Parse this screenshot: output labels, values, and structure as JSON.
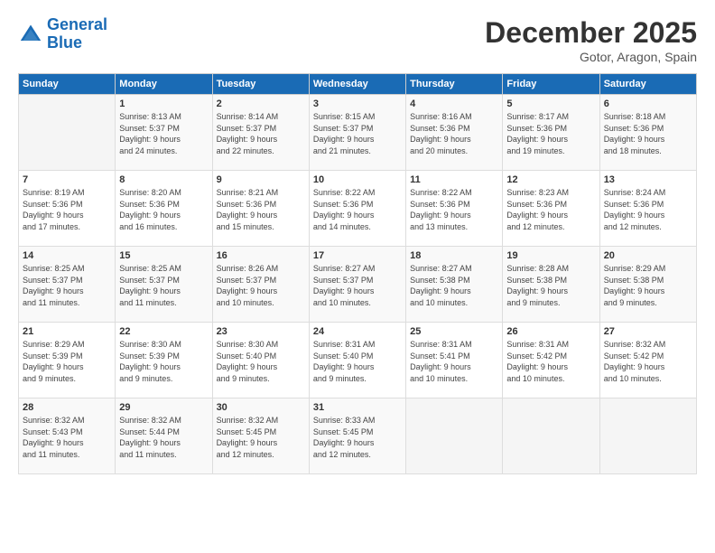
{
  "header": {
    "logo_line1": "General",
    "logo_line2": "Blue",
    "month": "December 2025",
    "location": "Gotor, Aragon, Spain"
  },
  "weekdays": [
    "Sunday",
    "Monday",
    "Tuesday",
    "Wednesday",
    "Thursday",
    "Friday",
    "Saturday"
  ],
  "weeks": [
    [
      {
        "day": "",
        "info": ""
      },
      {
        "day": "1",
        "info": "Sunrise: 8:13 AM\nSunset: 5:37 PM\nDaylight: 9 hours\nand 24 minutes."
      },
      {
        "day": "2",
        "info": "Sunrise: 8:14 AM\nSunset: 5:37 PM\nDaylight: 9 hours\nand 22 minutes."
      },
      {
        "day": "3",
        "info": "Sunrise: 8:15 AM\nSunset: 5:37 PM\nDaylight: 9 hours\nand 21 minutes."
      },
      {
        "day": "4",
        "info": "Sunrise: 8:16 AM\nSunset: 5:36 PM\nDaylight: 9 hours\nand 20 minutes."
      },
      {
        "day": "5",
        "info": "Sunrise: 8:17 AM\nSunset: 5:36 PM\nDaylight: 9 hours\nand 19 minutes."
      },
      {
        "day": "6",
        "info": "Sunrise: 8:18 AM\nSunset: 5:36 PM\nDaylight: 9 hours\nand 18 minutes."
      }
    ],
    [
      {
        "day": "7",
        "info": "Sunrise: 8:19 AM\nSunset: 5:36 PM\nDaylight: 9 hours\nand 17 minutes."
      },
      {
        "day": "8",
        "info": "Sunrise: 8:20 AM\nSunset: 5:36 PM\nDaylight: 9 hours\nand 16 minutes."
      },
      {
        "day": "9",
        "info": "Sunrise: 8:21 AM\nSunset: 5:36 PM\nDaylight: 9 hours\nand 15 minutes."
      },
      {
        "day": "10",
        "info": "Sunrise: 8:22 AM\nSunset: 5:36 PM\nDaylight: 9 hours\nand 14 minutes."
      },
      {
        "day": "11",
        "info": "Sunrise: 8:22 AM\nSunset: 5:36 PM\nDaylight: 9 hours\nand 13 minutes."
      },
      {
        "day": "12",
        "info": "Sunrise: 8:23 AM\nSunset: 5:36 PM\nDaylight: 9 hours\nand 12 minutes."
      },
      {
        "day": "13",
        "info": "Sunrise: 8:24 AM\nSunset: 5:36 PM\nDaylight: 9 hours\nand 12 minutes."
      }
    ],
    [
      {
        "day": "14",
        "info": "Sunrise: 8:25 AM\nSunset: 5:37 PM\nDaylight: 9 hours\nand 11 minutes."
      },
      {
        "day": "15",
        "info": "Sunrise: 8:25 AM\nSunset: 5:37 PM\nDaylight: 9 hours\nand 11 minutes."
      },
      {
        "day": "16",
        "info": "Sunrise: 8:26 AM\nSunset: 5:37 PM\nDaylight: 9 hours\nand 10 minutes."
      },
      {
        "day": "17",
        "info": "Sunrise: 8:27 AM\nSunset: 5:37 PM\nDaylight: 9 hours\nand 10 minutes."
      },
      {
        "day": "18",
        "info": "Sunrise: 8:27 AM\nSunset: 5:38 PM\nDaylight: 9 hours\nand 10 minutes."
      },
      {
        "day": "19",
        "info": "Sunrise: 8:28 AM\nSunset: 5:38 PM\nDaylight: 9 hours\nand 9 minutes."
      },
      {
        "day": "20",
        "info": "Sunrise: 8:29 AM\nSunset: 5:38 PM\nDaylight: 9 hours\nand 9 minutes."
      }
    ],
    [
      {
        "day": "21",
        "info": "Sunrise: 8:29 AM\nSunset: 5:39 PM\nDaylight: 9 hours\nand 9 minutes."
      },
      {
        "day": "22",
        "info": "Sunrise: 8:30 AM\nSunset: 5:39 PM\nDaylight: 9 hours\nand 9 minutes."
      },
      {
        "day": "23",
        "info": "Sunrise: 8:30 AM\nSunset: 5:40 PM\nDaylight: 9 hours\nand 9 minutes."
      },
      {
        "day": "24",
        "info": "Sunrise: 8:31 AM\nSunset: 5:40 PM\nDaylight: 9 hours\nand 9 minutes."
      },
      {
        "day": "25",
        "info": "Sunrise: 8:31 AM\nSunset: 5:41 PM\nDaylight: 9 hours\nand 10 minutes."
      },
      {
        "day": "26",
        "info": "Sunrise: 8:31 AM\nSunset: 5:42 PM\nDaylight: 9 hours\nand 10 minutes."
      },
      {
        "day": "27",
        "info": "Sunrise: 8:32 AM\nSunset: 5:42 PM\nDaylight: 9 hours\nand 10 minutes."
      }
    ],
    [
      {
        "day": "28",
        "info": "Sunrise: 8:32 AM\nSunset: 5:43 PM\nDaylight: 9 hours\nand 11 minutes."
      },
      {
        "day": "29",
        "info": "Sunrise: 8:32 AM\nSunset: 5:44 PM\nDaylight: 9 hours\nand 11 minutes."
      },
      {
        "day": "30",
        "info": "Sunrise: 8:32 AM\nSunset: 5:45 PM\nDaylight: 9 hours\nand 12 minutes."
      },
      {
        "day": "31",
        "info": "Sunrise: 8:33 AM\nSunset: 5:45 PM\nDaylight: 9 hours\nand 12 minutes."
      },
      {
        "day": "",
        "info": ""
      },
      {
        "day": "",
        "info": ""
      },
      {
        "day": "",
        "info": ""
      }
    ]
  ]
}
